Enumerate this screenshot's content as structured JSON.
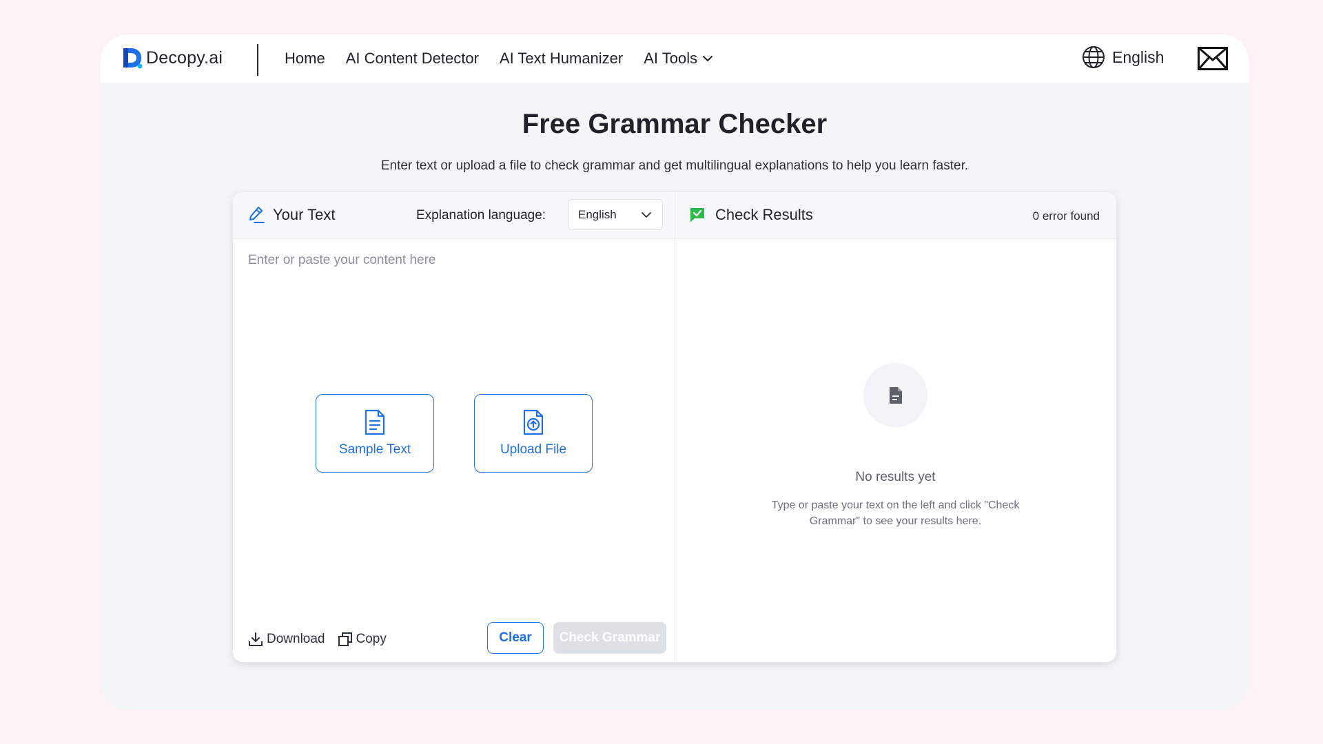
{
  "nav": {
    "logo_text": "Decopy.ai",
    "links": [
      "Home",
      "AI Content Detector",
      "AI Text Humanizer"
    ],
    "tools_label": "AI Tools",
    "language": "English"
  },
  "hero": {
    "title": "Free Grammar Checker",
    "subtitle": "Enter text or upload a file to check grammar and get multilingual explanations to help you learn faster."
  },
  "editor": {
    "title": "Your Text",
    "explanation_label": "Explanation  language:",
    "explanation_value": "English",
    "placeholder": "Enter or paste your content here",
    "sample_label": "Sample Text",
    "upload_label": "Upload File",
    "download_label": "Download",
    "copy_label": "Copy",
    "clear_label": "Clear",
    "check_label": "Check Grammar"
  },
  "results": {
    "title": "Check Results",
    "error_count": "0 error found",
    "empty_title": "No results yet",
    "empty_desc": "Type or paste your text on the left and click \"Check Grammar\" to see your results here."
  },
  "colors": {
    "accent": "#1f6fe5",
    "success": "#2db94d",
    "page_bg": "#fdf3f7",
    "frame_bg": "#f4f5f7",
    "disabled": "#dde0e4"
  },
  "icons": {
    "logo": "decopy-logo-icon",
    "tools": "chevron-down-icon",
    "language": "globe-icon",
    "mail": "mail-icon",
    "editor": "pencil-icon",
    "results": "check-flag-icon",
    "sample": "document-icon",
    "upload": "upload-file-icon",
    "download": "download-icon",
    "copy": "copy-icon",
    "empty": "file-icon"
  }
}
